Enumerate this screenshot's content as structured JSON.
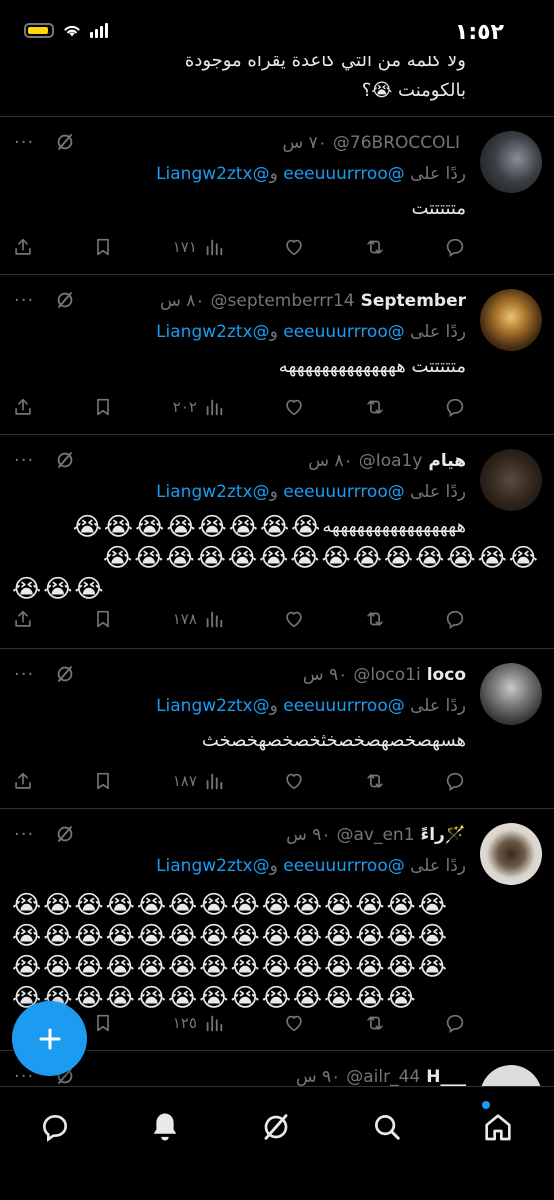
{
  "status": {
    "time": "١:٥٢"
  },
  "top_fragment": {
    "line1": "ولا كلمه من التي كاعدة يقراه موجودة",
    "line2": "بالكومنت 😭؟"
  },
  "reply_prefix": "ردًا على",
  "mention1": "@eeeuuurrroo",
  "mention_join": "و",
  "mention2": "@Liangw2ztx",
  "more_label": "···",
  "tweets": [
    {
      "name": "",
      "handle": "@76BROCCOLI",
      "time": "٧٠ س",
      "text": "متتتتتت",
      "views": "١٧١"
    },
    {
      "name": "September",
      "handle": "@septemberrr14",
      "time": "٨٠ س",
      "text": "متتتتتت ههههههههههههههه",
      "views": "٢٠٢"
    },
    {
      "name": "هيام",
      "handle": "@Ioa1y",
      "time": "٨٠ س",
      "text": "ههههههههههههههههه",
      "emoji_line1": "😭😭😭😭😭😭😭😭",
      "emoji_line2": "😭😭😭😭😭😭😭😭😭😭😭😭😭😭",
      "emoji_line3": "😭😭😭",
      "views": "١٧٨"
    },
    {
      "name": "loco",
      "handle": "@loco1i",
      "time": "٩٠ س",
      "text": "هسهصخصهصخصخثخصخصهخصخث",
      "views": "١٨٧"
    },
    {
      "name": "راءً🪄",
      "handle": "@av_en1",
      "time": "٩٠ س",
      "emoji_line1": "😭😭😭😭😭😭😭😭😭😭😭😭😭😭",
      "emoji_line2": "😭😭😭😭😭😭😭😭😭😭😭😭😭😭",
      "emoji_line3": "😭😭😭😭😭😭😭😭😭😭😭😭😭😭",
      "emoji_line4": "😭😭😭😭😭😭😭😭😭😭😭😭😭",
      "views": "١٢٥"
    },
    {
      "name": "H___",
      "handle": "@ailr_44",
      "time": "٩٠ س"
    }
  ],
  "colors": {
    "accent": "#1d9bf0",
    "muted": "#71767b",
    "background": "#000000",
    "battery": "#ffd60a"
  },
  "icons": [
    "battery-icon",
    "wifi-icon",
    "signal-icon",
    "reply-icon",
    "retweet-icon",
    "like-icon",
    "views-icon",
    "bookmark-icon",
    "share-icon",
    "grok-icon",
    "more-icon",
    "compose-icon",
    "home-icon",
    "search-icon",
    "notifications-icon",
    "messages-icon"
  ]
}
